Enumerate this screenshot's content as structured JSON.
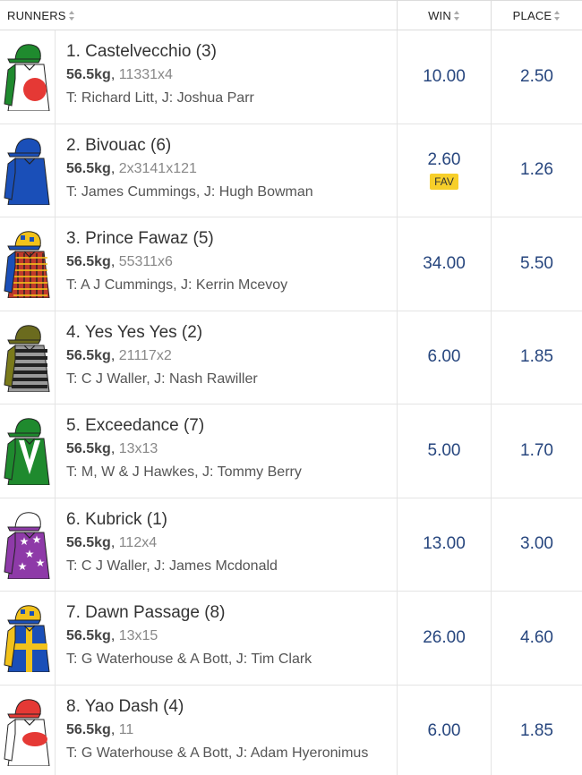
{
  "header": {
    "runners_label": "RUNNERS",
    "win_label": "WIN",
    "place_label": "PLACE"
  },
  "runners": [
    {
      "name": "1. Castelvecchio (3)",
      "weight": "56.5kg",
      "form": "11331x4",
      "trainer_jockey": "T: Richard Litt, J: Joshua Parr",
      "win": "10.00",
      "place": "2.50",
      "fav": "",
      "silk": {
        "cap": "#1f8a2e",
        "peak": "#1f8a2e",
        "body": "#ffffff",
        "sleeve": "#1f8a2e",
        "pattern": "red-ball",
        "accent": "#e53935",
        "icon": "jockey-silk-icon"
      }
    },
    {
      "name": "2. Bivouac (6)",
      "weight": "56.5kg",
      "form": "2x3141x121",
      "trainer_jockey": "T: James Cummings, J: Hugh Bowman",
      "win": "2.60",
      "place": "1.26",
      "fav": "FAV",
      "silk": {
        "cap": "#1a4fb8",
        "peak": "#1a4fb8",
        "body": "#1a4fb8",
        "sleeve": "#1a4fb8",
        "pattern": "plain",
        "accent": "#1a4fb8",
        "icon": "jockey-silk-icon"
      }
    },
    {
      "name": "3. Prince Fawaz (5)",
      "weight": "56.5kg",
      "form": "55311x6",
      "trainer_jockey": "T: A J Cummings, J: Kerrin Mcevoy",
      "win": "34.00",
      "place": "5.50",
      "fav": "",
      "silk": {
        "cap": "#f2c21b",
        "peak": "#1a4fb8",
        "body": "#c0392b",
        "sleeve": "#1a4fb8",
        "pattern": "tartan",
        "accent": "#f2c21b",
        "icon": "jockey-silk-icon"
      }
    },
    {
      "name": "4. Yes Yes Yes (2)",
      "weight": "56.5kg",
      "form": "21117x2",
      "trainer_jockey": "T: C J Waller, J: Nash Rawiller",
      "win": "6.00",
      "place": "1.85",
      "fav": "",
      "silk": {
        "cap": "#6b6b1e",
        "peak": "#6b6b1e",
        "body": "#9a9a9a",
        "sleeve": "#7a7a1a",
        "pattern": "hoops",
        "accent": "#222222",
        "icon": "jockey-silk-icon"
      }
    },
    {
      "name": "5. Exceedance (7)",
      "weight": "56.5kg",
      "form": "13x13",
      "trainer_jockey": "T: M, W & J Hawkes, J: Tommy Berry",
      "win": "5.00",
      "place": "1.70",
      "fav": "",
      "silk": {
        "cap": "#1f8a2e",
        "peak": "#1f8a2e",
        "body": "#1f8a2e",
        "sleeve": "#1f8a2e",
        "pattern": "white-v",
        "accent": "#ffffff",
        "icon": "jockey-silk-icon"
      }
    },
    {
      "name": "6. Kubrick (1)",
      "weight": "56.5kg",
      "form": "112x4",
      "trainer_jockey": "T: C J Waller, J: James Mcdonald",
      "win": "13.00",
      "place": "3.00",
      "fav": "",
      "silk": {
        "cap": "#ffffff",
        "peak": "#8e3aa8",
        "body": "#8e3aa8",
        "sleeve": "#8e3aa8",
        "pattern": "stars",
        "accent": "#ffffff",
        "icon": "jockey-silk-icon"
      }
    },
    {
      "name": "7. Dawn Passage (8)",
      "weight": "56.5kg",
      "form": "13x15",
      "trainer_jockey": "T: G Waterhouse & A Bott, J: Tim Clark",
      "win": "26.00",
      "place": "4.60",
      "fav": "",
      "silk": {
        "cap": "#f2c21b",
        "peak": "#1a4fb8",
        "body": "#1a4fb8",
        "sleeve": "#f2c21b",
        "pattern": "yellow-cross",
        "accent": "#f2c21b",
        "icon": "jockey-silk-icon"
      }
    },
    {
      "name": "8. Yao Dash (4)",
      "weight": "56.5kg",
      "form": "11",
      "trainer_jockey": "T: G Waterhouse & A Bott, J: Adam Hyeronimus",
      "win": "6.00",
      "place": "1.85",
      "fav": "",
      "silk": {
        "cap": "#e53935",
        "peak": "#e53935",
        "body": "#ffffff",
        "sleeve": "#ffffff",
        "pattern": "dynamic-logo",
        "accent": "#e53935",
        "icon": "jockey-silk-icon"
      }
    }
  ]
}
